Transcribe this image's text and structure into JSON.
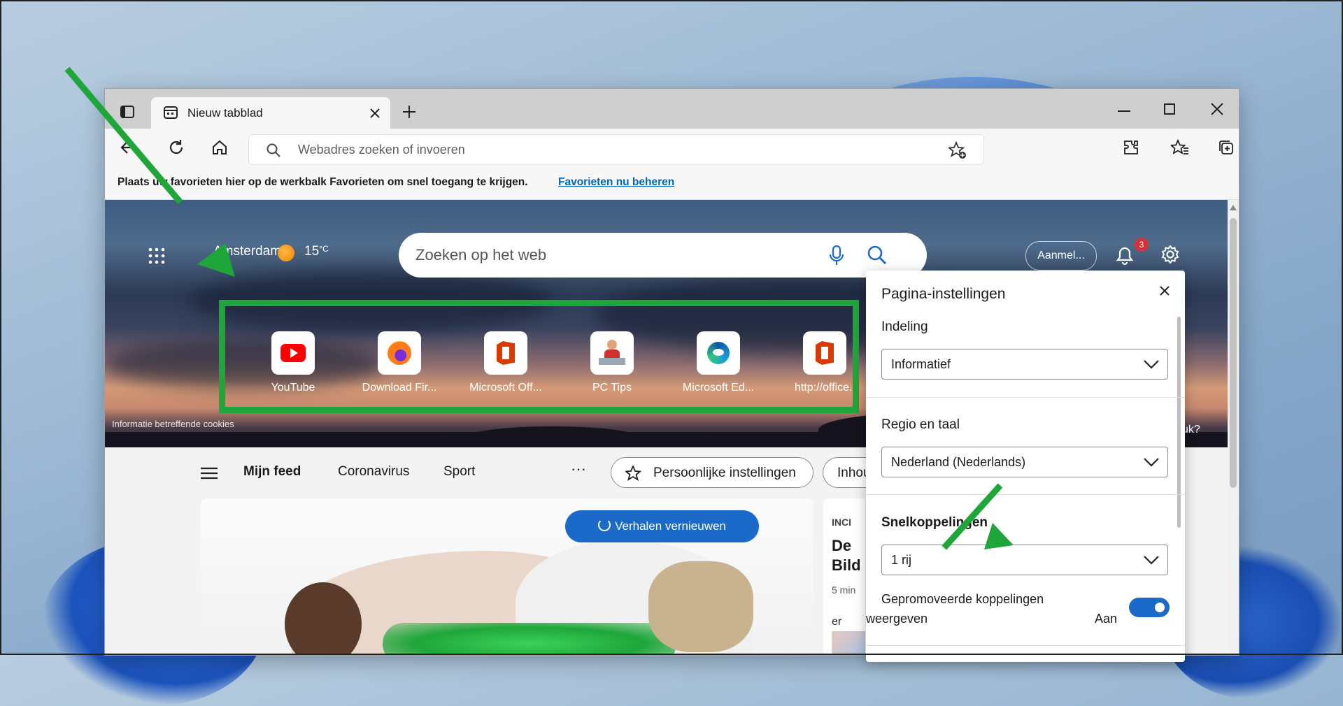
{
  "browser": {
    "tab_title": "Nieuw tabblad",
    "address_placeholder": "Webadres zoeken of invoeren",
    "favbar_text": "Plaats uw favorieten hier op de werkbalk Favorieten om snel toegang te krijgen.",
    "favbar_link": "Favorieten nu beheren"
  },
  "hero": {
    "weather_city": "Amsterdam",
    "weather_temp": "15",
    "weather_unit": "°C",
    "search_placeholder": "Zoeken op het web",
    "signin_label": "Aanmel...",
    "notification_count": "3",
    "cookie_text": "Informatie betreffende cookies",
    "right_fragment": "uk?"
  },
  "quick_links": [
    {
      "label": "YouTube",
      "icon": "youtube-icon"
    },
    {
      "label": "Download Fir...",
      "icon": "firefox-icon"
    },
    {
      "label": "Microsoft Off...",
      "icon": "office-icon"
    },
    {
      "label": "PC Tips",
      "icon": "pc-tips-icon"
    },
    {
      "label": "Microsoft Ed...",
      "icon": "edge-icon"
    },
    {
      "label": "http://office.l",
      "icon": "office-icon"
    }
  ],
  "feed_nav": {
    "items": [
      "Mijn feed",
      "Coronavirus",
      "Sport"
    ],
    "more": "···",
    "personalize": "Persoonlijke instellingen",
    "content_partial": "Inhou"
  },
  "feed": {
    "refresh_label": "Verhalen vernieuwen",
    "side_kicker": "INCI",
    "side_title_1": "De",
    "side_title_2": "Bild",
    "side_meta": "5 min",
    "side_fragment": "er"
  },
  "settings_panel": {
    "title": "Pagina-instellingen",
    "layout_heading": "Indeling",
    "layout_value": "Informatief",
    "region_heading": "Regio en taal",
    "region_value": "Nederland (Nederlands)",
    "shortcuts_heading": "Snelkoppelingen",
    "shortcuts_value": "1 rij",
    "promoted_label_1": "Gepromoveerde koppelingen",
    "promoted_label_2": "weergeven",
    "promoted_state": "Aan",
    "promoted_on": true
  },
  "colors": {
    "annotation_green": "#1fa63a",
    "accent_blue": "#1b6ac9",
    "badge_red": "#d13438"
  }
}
